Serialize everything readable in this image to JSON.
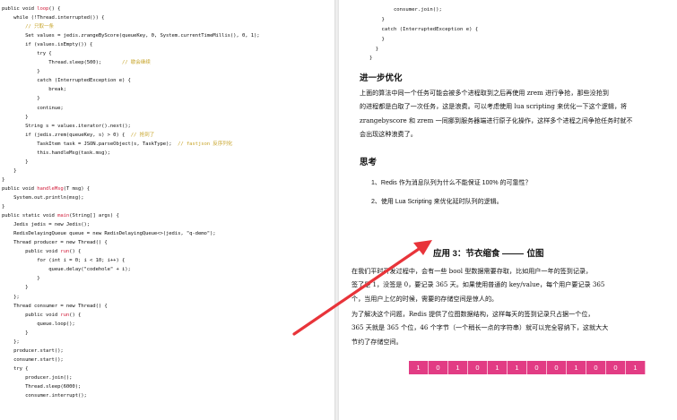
{
  "left_code": [
    [
      {
        "t": "public void "
      },
      {
        "t": "loop",
        "c": "fn"
      },
      {
        "t": "() {"
      }
    ],
    [
      {
        "t": "    while (!Thread.interrupted()) {"
      }
    ],
    [
      {
        "t": "        "
      },
      {
        "t": "// 只取一条",
        "c": "cm"
      }
    ],
    [
      {
        "t": "        Set values = jedis.zrangeByScore(queueKey, 0, System.currentTimeMillis(), 0, 1);"
      }
    ],
    [
      {
        "t": "        if (values.isEmpty()) {"
      }
    ],
    [
      {
        "t": "            try {"
      }
    ],
    [
      {
        "t": "                Thread.sleep(500);       "
      },
      {
        "t": "// 歇会继续",
        "c": "cm"
      }
    ],
    [
      {
        "t": "            }"
      }
    ],
    [
      {
        "t": "            catch (InterruptedException e) {"
      }
    ],
    [
      {
        "t": "                break;"
      }
    ],
    [
      {
        "t": "            }"
      }
    ],
    [
      {
        "t": "            continue;"
      }
    ],
    [
      {
        "t": "        }"
      }
    ],
    [
      {
        "t": "        String s = values.iterator().next();"
      }
    ],
    [
      {
        "t": "        if (jedis.zrem(queueKey, s) > 0) {  "
      },
      {
        "t": "// 抢到了",
        "c": "cm"
      }
    ],
    [
      {
        "t": "            TaskItem task = JSON.parseObject(s, TaskType);  "
      },
      {
        "t": "// fastjson 反序列化",
        "c": "cm"
      }
    ],
    [
      {
        "t": "            this.handleMsg(task.msg);"
      }
    ],
    [
      {
        "t": "        }"
      }
    ],
    [
      {
        "t": "    }"
      }
    ],
    [
      {
        "t": "}"
      }
    ],
    [
      {
        "t": "public void "
      },
      {
        "t": "handleMsg",
        "c": "fn"
      },
      {
        "t": "(T msg) {"
      }
    ],
    [
      {
        "t": "    System.out.println(msg);"
      }
    ],
    [
      {
        "t": "}"
      }
    ],
    [
      {
        "t": "public static void "
      },
      {
        "t": "main",
        "c": "fn"
      },
      {
        "t": "(String[] args) {"
      }
    ],
    [
      {
        "t": "    Jedis jedis = new Jedis();"
      }
    ],
    [
      {
        "t": "    RedisDelayingQueue queue = new RedisDelayingQueue<>(jedis, \"q-demo\");"
      }
    ],
    [
      {
        "t": "    Thread producer = new Thread() {"
      }
    ],
    [
      {
        "t": "        public void "
      },
      {
        "t": "run",
        "c": "fn"
      },
      {
        "t": "() {"
      }
    ],
    [
      {
        "t": "            for (int i = 0; i < 10; i++) {"
      }
    ],
    [
      {
        "t": "                queue.delay(\"codehole\" + i);"
      }
    ],
    [
      {
        "t": "            }"
      }
    ],
    [
      {
        "t": "        }"
      }
    ],
    [
      {
        "t": "    };"
      }
    ],
    [
      {
        "t": "    Thread consumer = new Thread() {"
      }
    ],
    [
      {
        "t": "        public void "
      },
      {
        "t": "run",
        "c": "fn"
      },
      {
        "t": "() {"
      }
    ],
    [
      {
        "t": "            queue.loop();"
      }
    ],
    [
      {
        "t": "        }"
      }
    ],
    [
      {
        "t": "    };"
      }
    ],
    [
      {
        "t": "    producer.start();"
      }
    ],
    [
      {
        "t": "    consumer.start();"
      }
    ],
    [
      {
        "t": "    try {"
      }
    ],
    [
      {
        "t": "        producer.join();"
      }
    ],
    [
      {
        "t": "        Thread.sleep(6000);"
      }
    ],
    [
      {
        "t": "        consumer.interrupt();"
      }
    ]
  ],
  "right_code": [
    [
      {
        "t": "        consumer.join();"
      }
    ],
    [
      {
        "t": "    }"
      }
    ],
    [
      {
        "t": "    catch (InterruptedException e) {"
      }
    ],
    [
      {
        "t": "    }"
      }
    ],
    [
      {
        "t": "  }"
      }
    ],
    [
      {
        "t": "}"
      }
    ]
  ],
  "section": {
    "title": "进一步优化",
    "paragraph": [
      "    上面的算法中同一个任务可能会被多个进程取到之后再使用 zrem 进行争抢，那些没抢到",
      "的进程都是白取了一次任务，这是浪费。可以考虑使用 lua scripting 来优化一下这个逻辑，将",
      "zrangebyscore 和 zrem 一同挪到服务器端进行原子化操作，这样多个进程之间争抢任务时就不",
      "会出现这种浪费了。"
    ]
  },
  "think": {
    "title": "思考",
    "questions": [
      "1、Redis 作为消息队列为什么不能保证 100% 的可靠性？",
      "2、使用 Lua Scripting 来优化延时队列的逻辑。"
    ]
  },
  "application": {
    "title_prefix": "应用 3：节衣缩食",
    "title_suffix": "位图"
  },
  "app_paragraph": [
    "    在我们平时开发过程中，会有一些 bool 型数据需要存取，比如用户一年的签到记录，",
    "签了是 1，没签是 0，要记录 365 天。如果使用普通的 key/value，每个用户要记录 365",
    "个，当用户上亿的时候，需要的存储空间是惊人的。"
  ],
  "app_paragraph2": [
    "    为了解决这个问题，Redis 提供了位图数据结构，这样每天的签到记录只占据一个位，",
    "365 天就是 365 个位，46 个字节（一个稍长一点的字符串）就可以完全容纳下，这就大大",
    "节约了存储空间。"
  ],
  "bitmap": [
    "1",
    "0",
    "1",
    "0",
    "1",
    "1",
    "0",
    "0",
    "1",
    "0",
    "0",
    "1"
  ],
  "colors": {
    "function_name": "#d21f3c",
    "comment": "#c7a42a",
    "bitmap_cell": "#e23c84",
    "arrow": "#e8343a"
  }
}
